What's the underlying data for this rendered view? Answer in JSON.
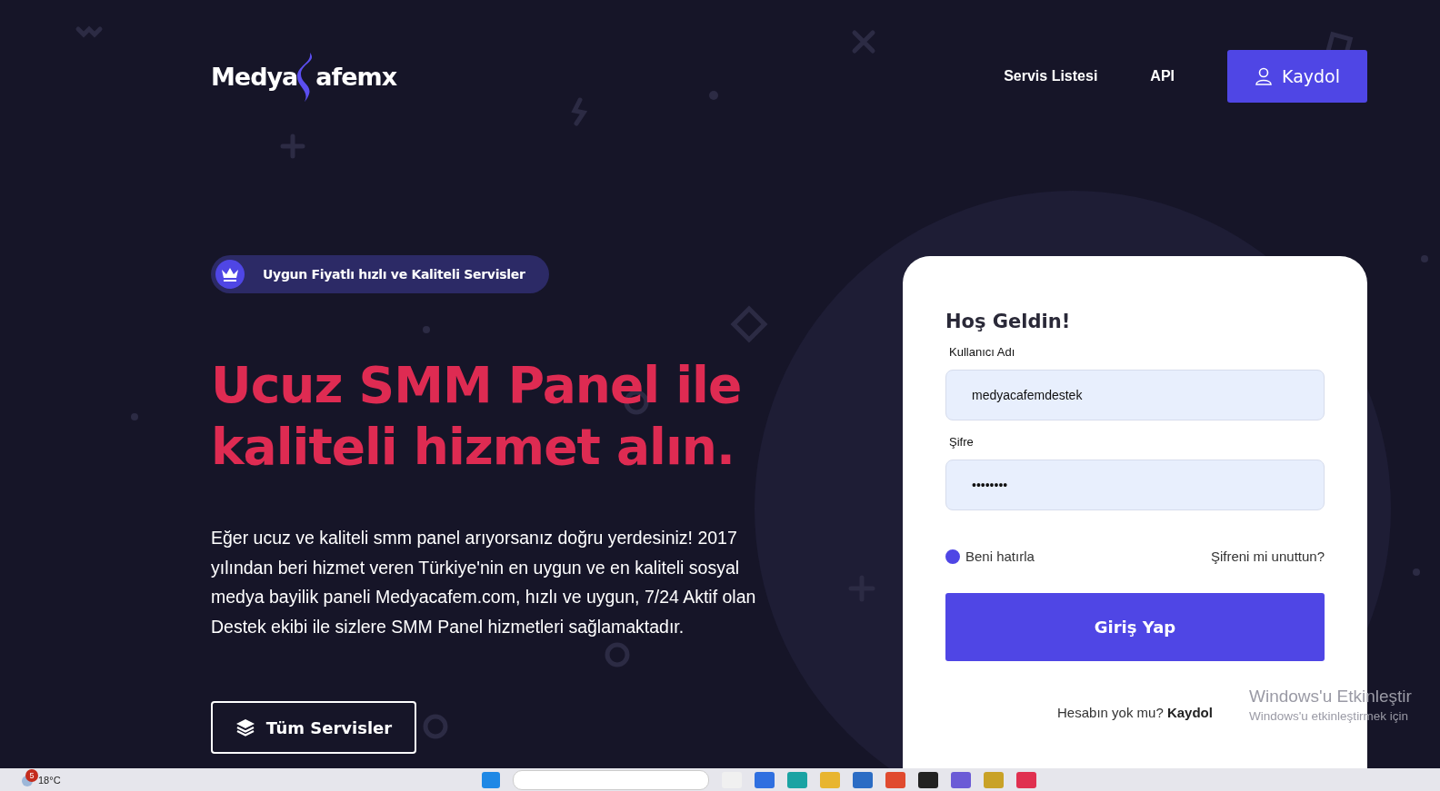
{
  "header": {
    "logo": {
      "left": "Medya",
      "right": "afemx"
    },
    "nav": [
      {
        "label": "Servis Listesi"
      },
      {
        "label": "API"
      }
    ],
    "signup_button": "Kaydol"
  },
  "hero": {
    "badge": "Uygun Fiyatlı hızlı ve Kaliteli Servisler",
    "heading": "Ucuz SMM Panel ile kaliteli hizmet alın.",
    "text": "Eğer ucuz ve kaliteli smm panel arıyorsanız doğru yerdesiniz! 2017 yılından beri hizmet veren Türkiye'nin en uygun ve en kaliteli sosyal medya bayilik paneli Medyacafem.com, hızlı ve uygun, 7/24 Aktif olan Destek ekibi ile sizlere SMM Panel hizmetleri sağlamaktadır.",
    "button": "Tüm Servisler"
  },
  "login": {
    "title": "Hoş Geldin!",
    "fields": [
      {
        "label": "Kullanıcı Adı",
        "value": "medyacafemdestek"
      },
      {
        "label": "Şifre",
        "value": "••••••••"
      }
    ],
    "remember": {
      "label": "Beni hatırla",
      "checked": true
    },
    "forgot": "Şifreni mi unuttun?",
    "submit": "Giriş Yap",
    "signup_prompt": "Hesabın yok mu?",
    "signup_link": "Kaydol"
  },
  "activation_notice": {
    "title": "Windows'u Etkinleştir",
    "text": "Windows'u etkinleştirmek için"
  },
  "taskbar": {
    "weather_badge": "5",
    "temperature": "18°C"
  }
}
